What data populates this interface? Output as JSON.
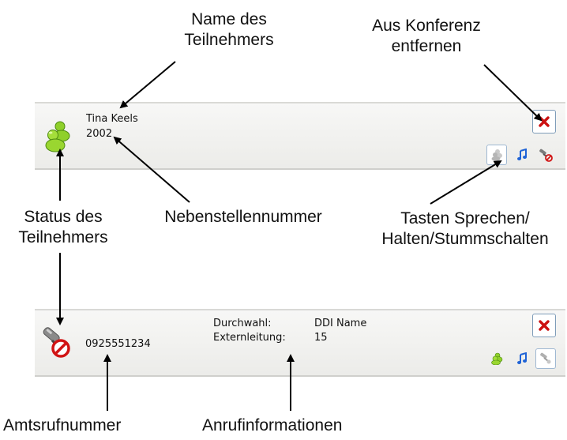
{
  "callouts": {
    "name_line1": "Name des",
    "name_line2": "Teilnehmers",
    "remove_line1": "Aus Konferenz",
    "remove_line2": "entfernen",
    "status_line1": "Status des",
    "status_line2": "Teilnehmers",
    "extension": "Nebenstellennummer",
    "buttons_line1": "Tasten Sprechen/",
    "buttons_line2": "Halten/Stummschalten",
    "external_number": "Amtsrufnummer",
    "call_info": "Anrufinformationen"
  },
  "panel1": {
    "name": "Tina Keels",
    "extension": "2002",
    "status_icon": "participants-icon",
    "buttons": [
      "talk-button",
      "hold-button",
      "mute-button"
    ]
  },
  "panel2": {
    "number": "0925551234",
    "ddi_label": "Durchwahl:",
    "ddi_value": "DDI Name",
    "line_label": "Externleitung:",
    "line_value": "15",
    "status_icon": "muted-handset-icon",
    "buttons": [
      "talk-button",
      "hold-button",
      "mute-button"
    ]
  },
  "colors": {
    "close_x": "#cc1111",
    "participant_green": "#7dc21e",
    "note_blue": "#1f63d6",
    "mute_red": "#d11414"
  }
}
